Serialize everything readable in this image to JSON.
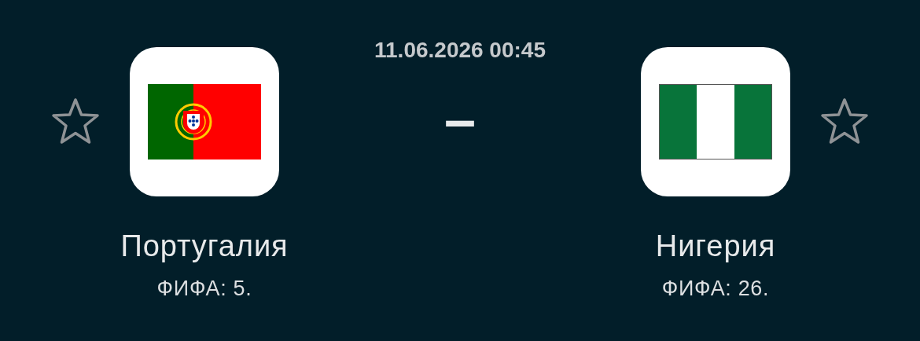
{
  "match": {
    "datetime": "11.06.2026 00:45",
    "separator": "–"
  },
  "teams": [
    {
      "name": "Португалия",
      "rank": "ФИФА: 5.",
      "favorite": false,
      "flag": {
        "kind": "portugal"
      }
    },
    {
      "name": "Нигерия",
      "rank": "ФИФА: 26.",
      "favorite": false,
      "flag": {
        "kind": "nigeria"
      }
    }
  ]
}
